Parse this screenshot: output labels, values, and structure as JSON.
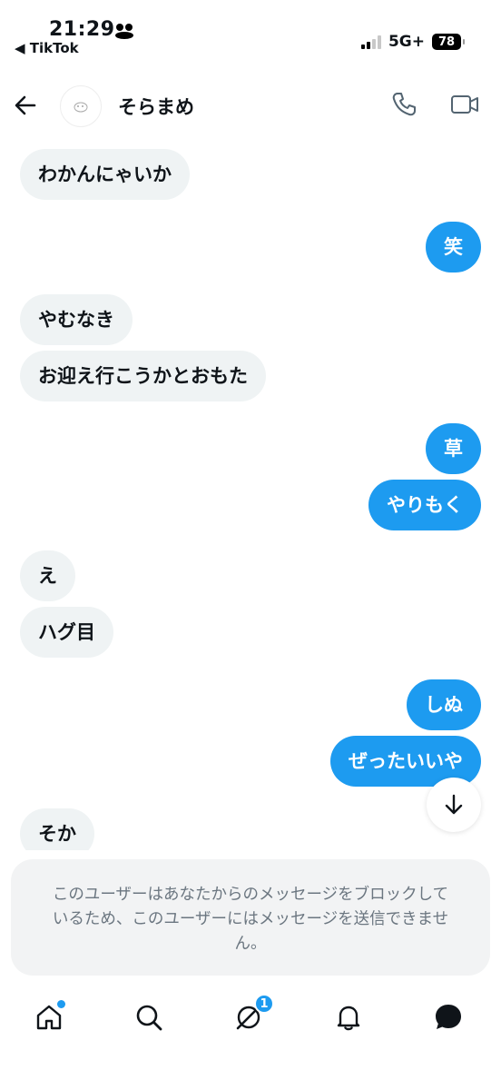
{
  "status_bar": {
    "time": "21:29",
    "back_app": "◀ TikTok",
    "network": "5G+",
    "battery": "78"
  },
  "header": {
    "contact_name": "そらまめ"
  },
  "messages": [
    {
      "side": "received",
      "text": "わかんにゃいか"
    },
    {
      "side": "sent",
      "text": "笑"
    },
    {
      "side": "received",
      "text": "やむなき"
    },
    {
      "side": "received",
      "text": "お迎え行こうかとおもた"
    },
    {
      "side": "sent",
      "text": "草"
    },
    {
      "side": "sent",
      "text": "やりもく"
    },
    {
      "side": "received",
      "text": "え"
    },
    {
      "side": "received",
      "text": "ハグ目"
    },
    {
      "side": "sent",
      "text": "しぬ"
    },
    {
      "side": "sent",
      "text": "ぜったいいや"
    },
    {
      "side": "received",
      "text": "そか"
    }
  ],
  "notice": {
    "line1": "このユーザーはあなたからのメッセージをブロックして",
    "line2": "いるため、このユーザーにはメッセージを送信できませ",
    "line3": "ん。"
  },
  "bottom_nav": {
    "items": [
      "home-icon",
      "search-icon",
      "grok-icon",
      "notifications-icon",
      "messages-icon"
    ],
    "grok_badge": "1"
  },
  "colors": {
    "accent": "#1d9bf0",
    "received_bubble": "#eff3f4",
    "notice_bg": "#f2f3f4"
  }
}
